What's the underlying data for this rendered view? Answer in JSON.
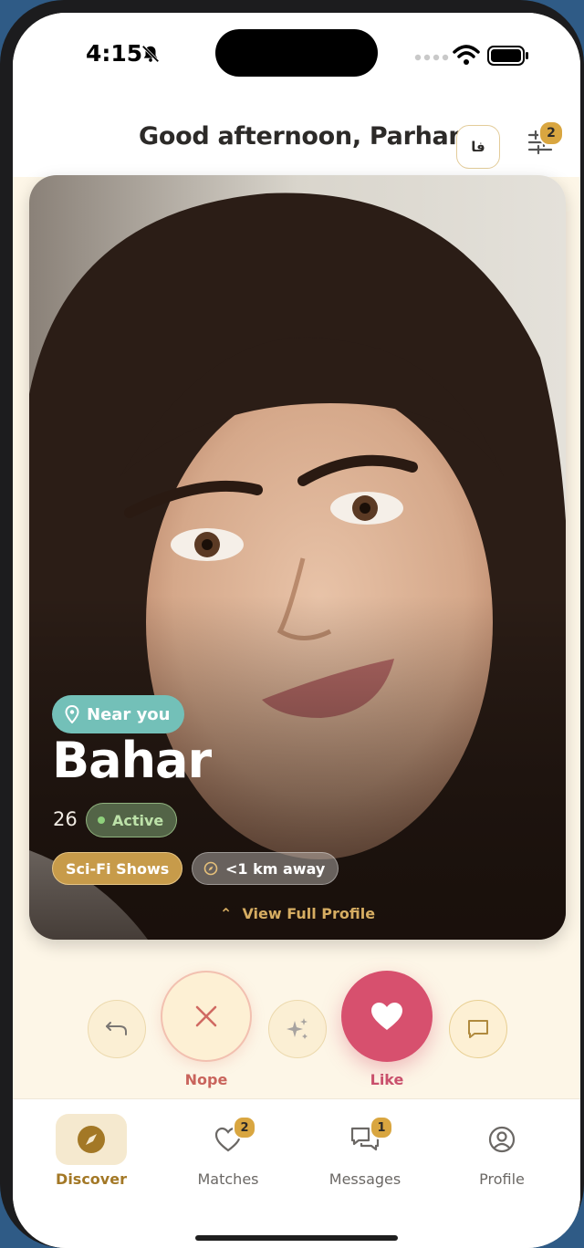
{
  "status_bar": {
    "time": "4:15"
  },
  "header": {
    "greeting": "Good afternoon, Parham",
    "language_button": "فا",
    "filter_badge": "2"
  },
  "profile_card": {
    "location_badge": "Near you",
    "name": "Bahar",
    "age": "26",
    "status": "Active",
    "interest": "Sci-Fi Shows",
    "distance": "<1 km away",
    "view_profile": "View Full Profile"
  },
  "actions": {
    "nope_label": "Nope",
    "like_label": "Like"
  },
  "tabs": [
    {
      "label": "Discover",
      "icon": "compass-icon",
      "active": true
    },
    {
      "label": "Matches",
      "icon": "heart-icon",
      "badge": "2"
    },
    {
      "label": "Messages",
      "icon": "messages-icon",
      "badge": "1"
    },
    {
      "label": "Profile",
      "icon": "profile-icon"
    }
  ],
  "colors": {
    "accent": "#d9a640",
    "like": "#d7506e",
    "nope": "#c9645c",
    "teal": "#73c0b8",
    "background": "#fdf6e7"
  }
}
